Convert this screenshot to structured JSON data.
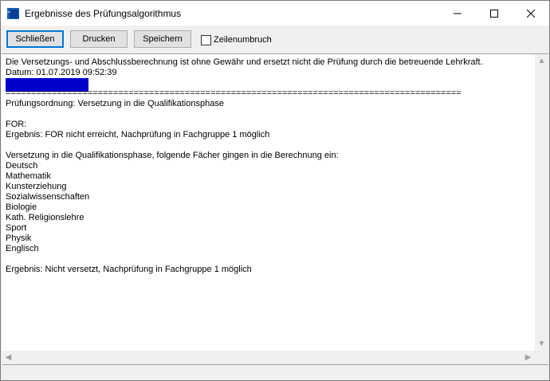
{
  "window": {
    "title": "Ergebnisse des Prüfungsalgorithmus"
  },
  "toolbar": {
    "close_label": "Schließen",
    "print_label": "Drucken",
    "save_label": "Speichern",
    "wrap_label": "Zeilenumbruch",
    "wrap_checked": false
  },
  "result": {
    "lines": [
      "Die Versetzungs- und Abschlussberechnung ist ohne Gewähr und ersetzt nicht die Prüfung durch die betreuende Lehrkraft.",
      "Datum: 01.07.2019 09:52:39",
      "",
      "=========================================================================================",
      "Prüfungsordnung: Versetzung in die Qualifikationsphase",
      "",
      "FOR:",
      "Ergebnis: FOR nicht erreicht, Nachprüfung in Fachgruppe 1 möglich",
      "",
      "Versetzung in die Qualifikationsphase, folgende Fächer gingen in die Berechnung ein:",
      "Deutsch",
      "Mathematik",
      "Kunsterziehung",
      "Sozialwissenschaften",
      "Biologie",
      "Kath. Religionslehre",
      "Sport",
      "Physik",
      "Englisch",
      "",
      "Ergebnis: Nicht versetzt, Nachprüfung in Fachgruppe 1 möglich"
    ]
  }
}
